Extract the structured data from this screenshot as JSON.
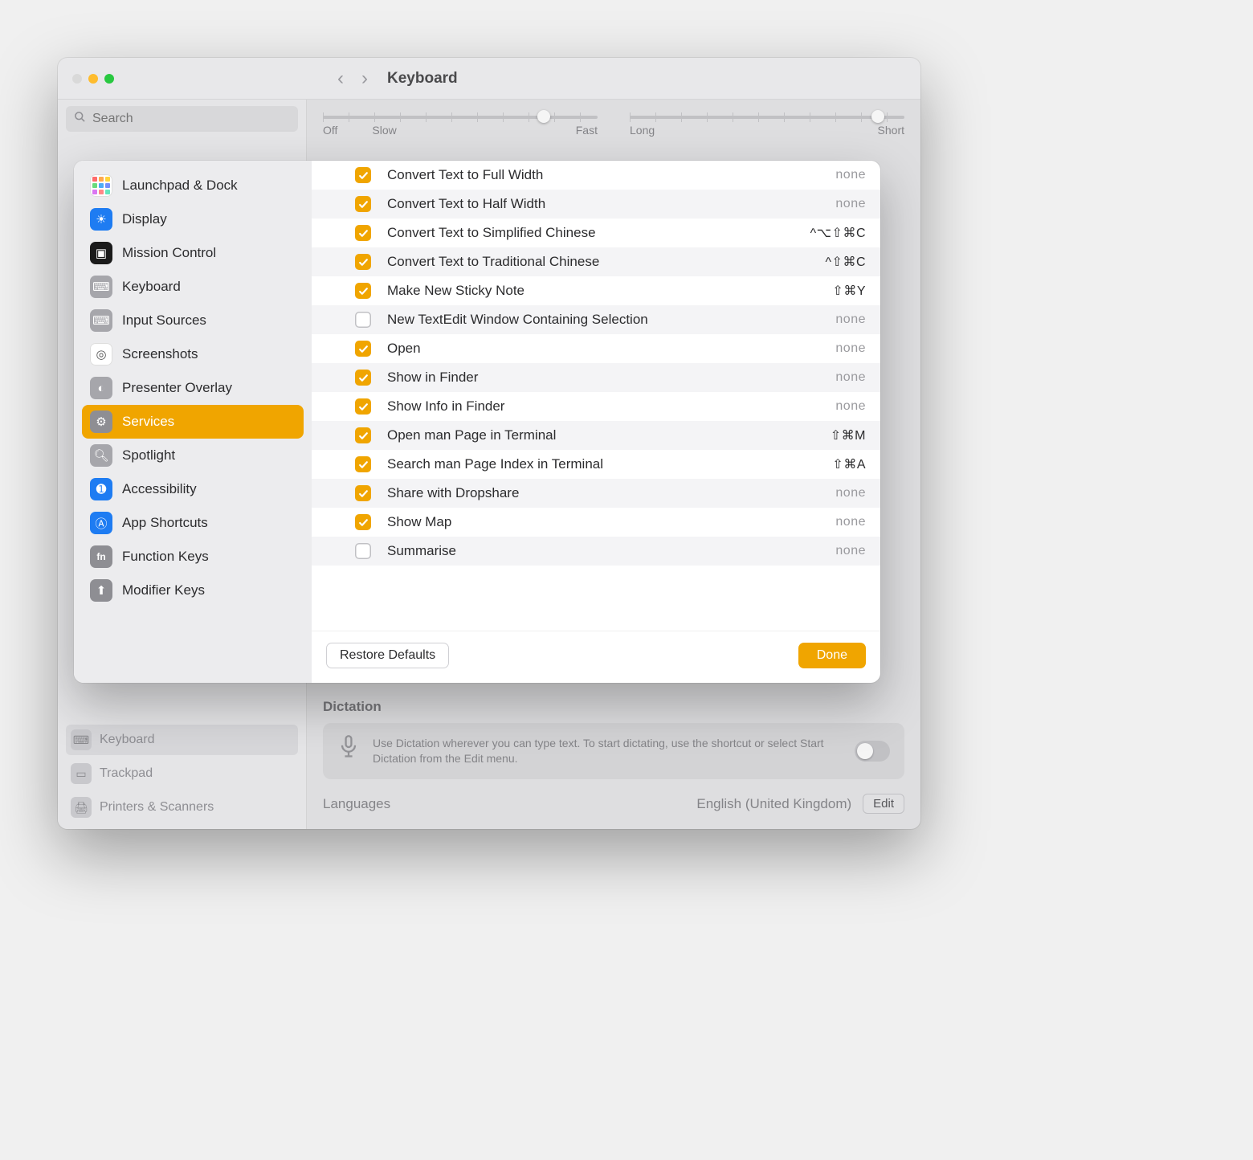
{
  "window": {
    "title": "Keyboard"
  },
  "bg_sidebar": {
    "search_placeholder": "Search",
    "items": [
      {
        "label": "Keyboard"
      },
      {
        "label": "Trackpad"
      },
      {
        "label": "Printers & Scanners"
      }
    ]
  },
  "bg_content": {
    "slider1": {
      "left": "Off",
      "left2": "Slow",
      "right": "Fast"
    },
    "slider2": {
      "left": "Long",
      "right": "Short"
    },
    "dictation_heading": "Dictation",
    "dictation_text": "Use Dictation wherever you can type text. To start dictating, use the shortcut or select Start Dictation from the Edit menu.",
    "languages_label": "Languages",
    "languages_value": "English (United Kingdom)",
    "edit_label": "Edit"
  },
  "sheet": {
    "categories": [
      {
        "id": "launchpad",
        "label": "Launchpad & Dock"
      },
      {
        "id": "display",
        "label": "Display"
      },
      {
        "id": "mission",
        "label": "Mission Control"
      },
      {
        "id": "keyboard",
        "label": "Keyboard"
      },
      {
        "id": "input",
        "label": "Input Sources"
      },
      {
        "id": "screenshots",
        "label": "Screenshots"
      },
      {
        "id": "presenter",
        "label": "Presenter Overlay"
      },
      {
        "id": "services",
        "label": "Services"
      },
      {
        "id": "spotlight",
        "label": "Spotlight"
      },
      {
        "id": "accessibility",
        "label": "Accessibility"
      },
      {
        "id": "appshortcuts",
        "label": "App Shortcuts"
      },
      {
        "id": "functionkeys",
        "label": "Function Keys"
      },
      {
        "id": "modifier",
        "label": "Modifier Keys"
      }
    ],
    "selected_category": "services",
    "services": [
      {
        "checked": true,
        "label": "Convert Text to Full Width",
        "shortcut": "none"
      },
      {
        "checked": true,
        "label": "Convert Text to Half Width",
        "shortcut": "none"
      },
      {
        "checked": true,
        "label": "Convert Text to Simplified Chinese",
        "shortcut": "^⌥⇧⌘C"
      },
      {
        "checked": true,
        "label": "Convert Text to Traditional Chinese",
        "shortcut": "^⇧⌘C"
      },
      {
        "checked": true,
        "label": "Make New Sticky Note",
        "shortcut": "⇧⌘Y"
      },
      {
        "checked": false,
        "label": "New TextEdit Window Containing Selection",
        "shortcut": "none"
      },
      {
        "checked": true,
        "label": "Open",
        "shortcut": "none"
      },
      {
        "checked": true,
        "label": "Show in Finder",
        "shortcut": "none"
      },
      {
        "checked": true,
        "label": "Show Info in Finder",
        "shortcut": "none"
      },
      {
        "checked": true,
        "label": "Open man Page in Terminal",
        "shortcut": "⇧⌘M"
      },
      {
        "checked": true,
        "label": "Search man Page Index in Terminal",
        "shortcut": "⇧⌘A"
      },
      {
        "checked": true,
        "label": "Share with Dropshare",
        "shortcut": "none"
      },
      {
        "checked": true,
        "label": "Show Map",
        "shortcut": "none"
      },
      {
        "checked": false,
        "label": "Summarise",
        "shortcut": "none"
      }
    ],
    "restore_label": "Restore Defaults",
    "done_label": "Done"
  }
}
